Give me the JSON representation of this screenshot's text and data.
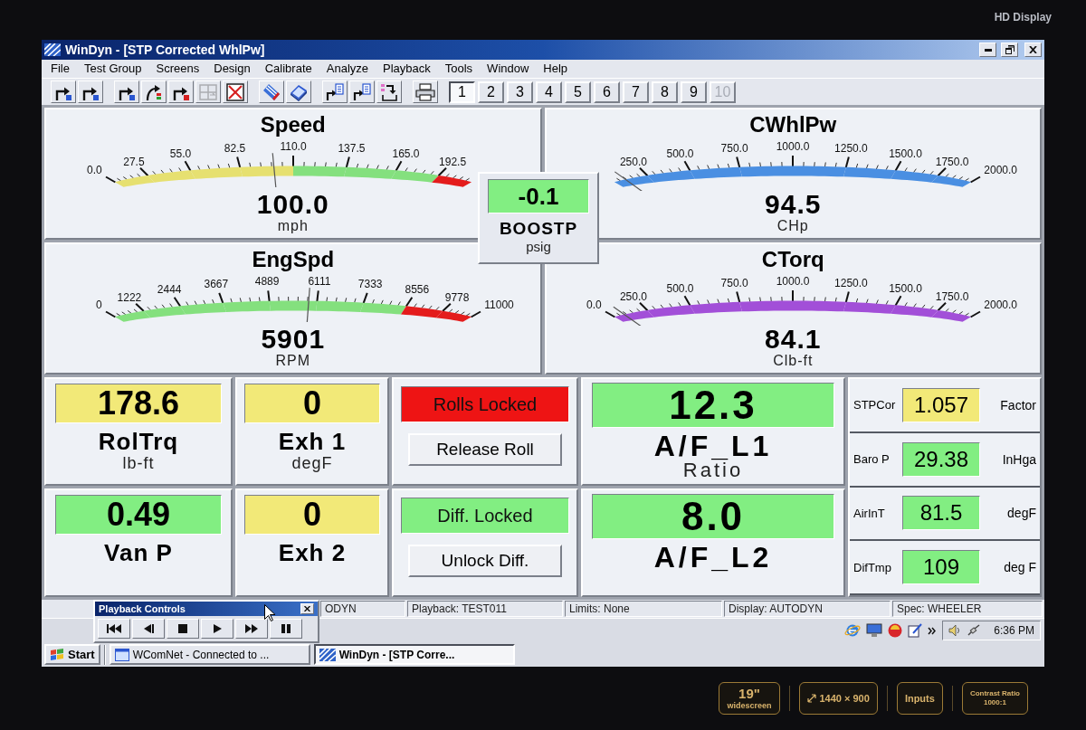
{
  "monitor": {
    "label": "HD Display",
    "badges": [
      {
        "kind": "size",
        "lines": [
          "19\"",
          "widescreen"
        ]
      },
      {
        "kind": "resolution",
        "lines": [
          "1440 × 900"
        ]
      },
      {
        "kind": "inputs",
        "lines": [
          "Inputs"
        ]
      },
      {
        "kind": "contrast",
        "lines": [
          "Contrast Ratio",
          "1000:1"
        ]
      }
    ]
  },
  "window": {
    "title": "WinDyn - [STP Corrected WhlPw]"
  },
  "menu": [
    "File",
    "Test Group",
    "Screens",
    "Design",
    "Calibrate",
    "Analyze",
    "Playback",
    "Tools",
    "Window",
    "Help"
  ],
  "toolbar": {
    "tool_groups": [
      {
        "tools": [
          {
            "kind": "bent-arrow",
            "disabled": false
          },
          {
            "kind": "bent-arrow",
            "disabled": false
          }
        ]
      },
      {
        "tools": [
          {
            "kind": "bent-arrow",
            "disabled": false
          },
          {
            "kind": "curved-arrow",
            "disabled": false
          },
          {
            "kind": "bent-arrow-red",
            "disabled": false
          },
          {
            "kind": "grid",
            "disabled": true
          },
          {
            "kind": "crossed-box",
            "disabled": false
          }
        ]
      },
      {
        "tools": [
          {
            "kind": "ruler",
            "disabled": false
          },
          {
            "kind": "book",
            "disabled": false
          }
        ]
      },
      {
        "tools": [
          {
            "kind": "arrow-document",
            "disabled": false
          },
          {
            "kind": "arrow-document",
            "disabled": false
          },
          {
            "kind": "tray-arrow",
            "disabled": false
          }
        ]
      },
      {
        "tools": [
          {
            "kind": "printer",
            "disabled": false
          }
        ]
      }
    ],
    "screens": [
      {
        "label": "1",
        "selected": true,
        "disabled": false
      },
      {
        "label": "2",
        "selected": false,
        "disabled": false
      },
      {
        "label": "3",
        "selected": false,
        "disabled": false
      },
      {
        "label": "4",
        "selected": false,
        "disabled": false
      },
      {
        "label": "5",
        "selected": false,
        "disabled": false
      },
      {
        "label": "6",
        "selected": false,
        "disabled": false
      },
      {
        "label": "7",
        "selected": false,
        "disabled": false
      },
      {
        "label": "8",
        "selected": false,
        "disabled": false
      },
      {
        "label": "9",
        "selected": false,
        "disabled": false
      },
      {
        "label": "10",
        "selected": false,
        "disabled": true
      }
    ]
  },
  "gauges": [
    {
      "title": "Speed",
      "value": "100.0",
      "unit": "mph",
      "level": 0.455,
      "ticks": [
        "0.0",
        "27.5",
        "55.0",
        "82.5",
        "110.0",
        "137.5",
        "165.0",
        "192.5"
      ],
      "first_tick_covered": false,
      "last_tick_covered": true,
      "segments": [
        {
          "color": "#e6e070"
        },
        {
          "color": "#e6e070"
        },
        {
          "color": "#e6e070"
        },
        {
          "color": "#e6e070"
        },
        {
          "color": "#84e07e"
        },
        {
          "color": "#84e07e"
        },
        {
          "color": "#84e07e"
        },
        {
          "color": "#e41c1c"
        }
      ]
    },
    {
      "title": "CWhlPw",
      "value": "94.5",
      "unit": "CHp",
      "level": 0.047,
      "ticks": [
        "250.0",
        "500.0",
        "750.0",
        "1000.0",
        "1250.0",
        "1500.0",
        "1750.0",
        "2000.0"
      ],
      "first_tick_covered": true,
      "last_tick_covered": false,
      "segments": [
        {
          "color": "#4a8fe2"
        },
        {
          "color": "#4a8fe2"
        },
        {
          "color": "#4a8fe2"
        },
        {
          "color": "#4a8fe2"
        },
        {
          "color": "#4a8fe2"
        },
        {
          "color": "#4a8fe2"
        },
        {
          "color": "#4a8fe2"
        },
        {
          "color": "#4a8fe2"
        }
      ]
    },
    {
      "title": "EngSpd",
      "value": "5901",
      "unit": "RPM",
      "level": 0.536,
      "ticks": [
        "0",
        "1222",
        "2444",
        "3667",
        "4889",
        "6111",
        "7333",
        "8556",
        "9778",
        "11000"
      ],
      "first_tick_covered": false,
      "last_tick_covered": false,
      "segments": [
        {
          "color": "#84e07e"
        },
        {
          "color": "#84e07e"
        },
        {
          "color": "#84e07e"
        },
        {
          "color": "#84e07e"
        },
        {
          "color": "#84e07e"
        },
        {
          "color": "#84e07e"
        },
        {
          "color": "#84e07e"
        },
        {
          "color": "#e41c1c"
        },
        {
          "color": "#e41c1c"
        }
      ]
    },
    {
      "title": "CTorq",
      "value": "84.1",
      "unit": "Clb-ft",
      "level": 0.042,
      "ticks": [
        "0.0",
        "250.0",
        "500.0",
        "750.0",
        "1000.0",
        "1250.0",
        "1500.0",
        "1750.0",
        "2000.0"
      ],
      "first_tick_covered": false,
      "last_tick_covered": false,
      "segments": [
        {
          "color": "#a24fd8"
        },
        {
          "color": "#a24fd8"
        },
        {
          "color": "#a24fd8"
        },
        {
          "color": "#a24fd8"
        },
        {
          "color": "#a24fd8"
        },
        {
          "color": "#a24fd8"
        },
        {
          "color": "#a24fd8"
        },
        {
          "color": "#a24fd8"
        }
      ]
    }
  ],
  "boost": {
    "value": "-0.1",
    "color": "#82ee82",
    "label": "BOOSTP",
    "unit": "psig"
  },
  "readouts": [
    {
      "value": "178.6",
      "color": "#f2e978",
      "label": "RolTrq",
      "unit": "lb-ft"
    },
    {
      "value": "0",
      "color": "#f2e978",
      "label": "Exh 1",
      "unit": "degF"
    },
    {
      "value": "0.49",
      "color": "#82ee82",
      "label": "Van P"
    },
    {
      "value": "0",
      "color": "#f2e978",
      "label": "Exh 2"
    }
  ],
  "roll_controls": [
    {
      "status": "Rolls Locked",
      "color": "#ee1414",
      "button": "Release Roll"
    },
    {
      "status": "Diff. Locked",
      "color": "#82ee82",
      "button": "Unlock Diff."
    }
  ],
  "air_fuel": [
    {
      "value": "12.3",
      "color": "#82ee82",
      "label": "A/F_L1",
      "unit": "Ratio"
    },
    {
      "value": "8.0",
      "color": "#82ee82",
      "label": "A/F_L2"
    }
  ],
  "conditions": [
    {
      "label": "STPCor",
      "value": "1.057",
      "color": "#f2e978",
      "unit": "Factor"
    },
    {
      "label": "Baro P",
      "value": "29.38",
      "color": "#82ee82",
      "unit": "InHga"
    },
    {
      "label": "AirInT",
      "value": "81.5",
      "color": "#82ee82",
      "unit": "degF"
    },
    {
      "label": "DifTmp",
      "value": "109",
      "color": "#82ee82",
      "unit": "deg F"
    }
  ],
  "status_bar": [
    "ODYN",
    "Playback: TEST011",
    "Limits: None",
    "Display: AUTODYN",
    "Spec: WHEELER"
  ],
  "playback_controls": {
    "title": "Playback Controls"
  },
  "taskbar": {
    "start": "Start",
    "buttons": [
      {
        "kind": "network",
        "label": "WComNet - Connected to ...",
        "selected": false
      },
      {
        "kind": "app",
        "label": "WinDyn - [STP Corre...",
        "selected": true
      }
    ],
    "clock": "6:36 PM"
  }
}
